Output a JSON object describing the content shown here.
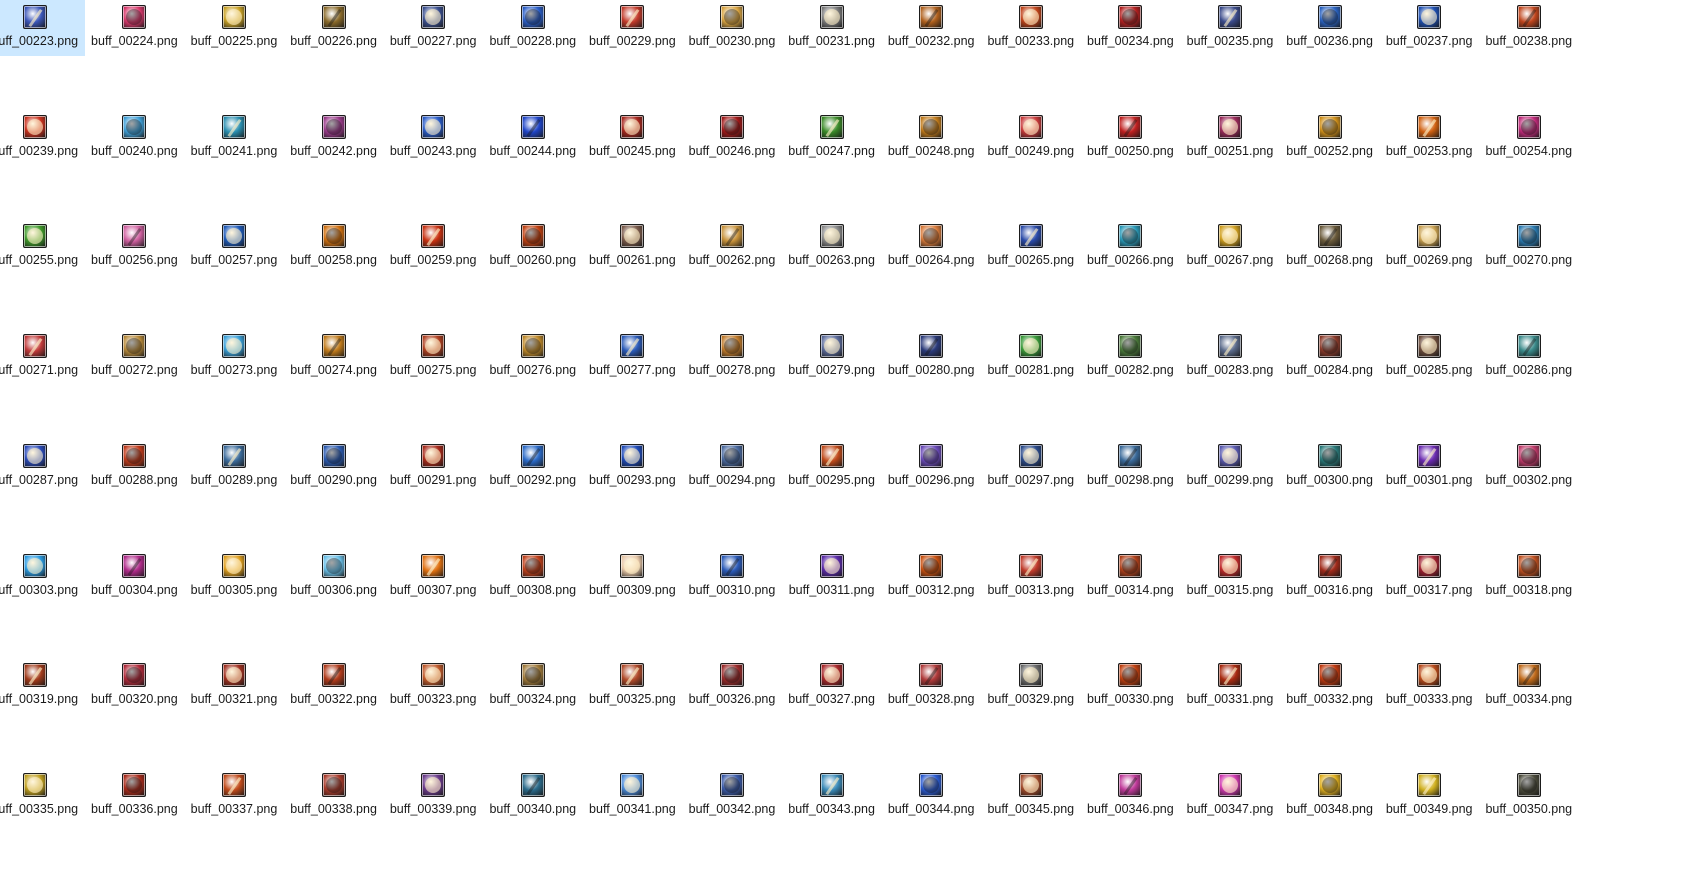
{
  "file_view": {
    "selected_file": "buff_00223.png",
    "files": [
      "buff_00223.png",
      "buff_00224.png",
      "buff_00225.png",
      "buff_00226.png",
      "buff_00227.png",
      "buff_00228.png",
      "buff_00229.png",
      "buff_00230.png",
      "buff_00231.png",
      "buff_00232.png",
      "buff_00233.png",
      "buff_00234.png",
      "buff_00235.png",
      "buff_00236.png",
      "buff_00237.png",
      "buff_00238.png",
      "buff_00239.png",
      "buff_00240.png",
      "buff_00241.png",
      "buff_00242.png",
      "buff_00243.png",
      "buff_00244.png",
      "buff_00245.png",
      "buff_00246.png",
      "buff_00247.png",
      "buff_00248.png",
      "buff_00249.png",
      "buff_00250.png",
      "buff_00251.png",
      "buff_00252.png",
      "buff_00253.png",
      "buff_00254.png",
      "buff_00255.png",
      "buff_00256.png",
      "buff_00257.png",
      "buff_00258.png",
      "buff_00259.png",
      "buff_00260.png",
      "buff_00261.png",
      "buff_00262.png",
      "buff_00263.png",
      "buff_00264.png",
      "buff_00265.png",
      "buff_00266.png",
      "buff_00267.png",
      "buff_00268.png",
      "buff_00269.png",
      "buff_00270.png",
      "buff_00271.png",
      "buff_00272.png",
      "buff_00273.png",
      "buff_00274.png",
      "buff_00275.png",
      "buff_00276.png",
      "buff_00277.png",
      "buff_00278.png",
      "buff_00279.png",
      "buff_00280.png",
      "buff_00281.png",
      "buff_00282.png",
      "buff_00283.png",
      "buff_00284.png",
      "buff_00285.png",
      "buff_00286.png",
      "buff_00287.png",
      "buff_00288.png",
      "buff_00289.png",
      "buff_00290.png",
      "buff_00291.png",
      "buff_00292.png",
      "buff_00293.png",
      "buff_00294.png",
      "buff_00295.png",
      "buff_00296.png",
      "buff_00297.png",
      "buff_00298.png",
      "buff_00299.png",
      "buff_00300.png",
      "buff_00301.png",
      "buff_00302.png",
      "buff_00303.png",
      "buff_00304.png",
      "buff_00305.png",
      "buff_00306.png",
      "buff_00307.png",
      "buff_00308.png",
      "buff_00309.png",
      "buff_00310.png",
      "buff_00311.png",
      "buff_00312.png",
      "buff_00313.png",
      "buff_00314.png",
      "buff_00315.png",
      "buff_00316.png",
      "buff_00317.png",
      "buff_00318.png",
      "buff_00319.png",
      "buff_00320.png",
      "buff_00321.png",
      "buff_00322.png",
      "buff_00323.png",
      "buff_00324.png",
      "buff_00325.png",
      "buff_00326.png",
      "buff_00327.png",
      "buff_00328.png",
      "buff_00329.png",
      "buff_00330.png",
      "buff_00331.png",
      "buff_00332.png",
      "buff_00333.png",
      "buff_00334.png",
      "buff_00335.png",
      "buff_00336.png",
      "buff_00337.png",
      "buff_00338.png",
      "buff_00339.png",
      "buff_00340.png",
      "buff_00341.png",
      "buff_00342.png",
      "buff_00343.png",
      "buff_00344.png",
      "buff_00345.png",
      "buff_00346.png",
      "buff_00347.png",
      "buff_00348.png",
      "buff_00349.png",
      "buff_00350.png"
    ],
    "thumb_colors": [
      "#3b56b8",
      "#d8386b",
      "#c9a227",
      "#8a6a2a",
      "#3a4f8f",
      "#2a5ec8",
      "#c23a2a",
      "#d9a441",
      "#7a7a7a",
      "#b0601c",
      "#c0441a",
      "#b32020",
      "#3a4a8a",
      "#2a62c0",
      "#1e4fb0",
      "#c0451c",
      "#c9321e",
      "#3fa0d8",
      "#2a8fb0",
      "#9a3a8a",
      "#2a5cc8",
      "#1e44c8",
      "#a8281e",
      "#a01818",
      "#3a8a28",
      "#c07a1a",
      "#c83a3a",
      "#c02020",
      "#9a2a5a",
      "#d0901a",
      "#d06010",
      "#c02a7a",
      "#3f9a2a",
      "#d060a0",
      "#1e5ab8",
      "#d07010",
      "#c83010",
      "#c04010",
      "#7a5a4a",
      "#c8923a",
      "#8a8a8a",
      "#d87a3a",
      "#2a4aa8",
      "#2a9ab8",
      "#d0a020",
      "#6a5a3a",
      "#c8a050",
      "#2a7ab0",
      "#c03a3a",
      "#b88a3a",
      "#3aa0d8",
      "#c07a1a",
      "#b04020",
      "#c08a2a",
      "#2a5ab8",
      "#c07a2a",
      "#5a6a9a",
      "#2a3a7a",
      "#3a9a3a",
      "#4a7a3a",
      "#5a6a8a",
      "#8a3a2a",
      "#6a4a3a",
      "#3a8a8a",
      "#2a4ab8",
      "#c03a1a",
      "#3a6a9a",
      "#2a5ab0",
      "#a82a1a",
      "#2a6ac8",
      "#1e4ab8",
      "#4a6aa0",
      "#c04a1a",
      "#6a4ab8",
      "#2a4a8a",
      "#3a6a9a",
      "#5a5ab0",
      "#2a7a7a",
      "#6a2ab0",
      "#c03a6a",
      "#2a9ae0",
      "#b02a8a",
      "#e0a020",
      "#6ac0e8",
      "#e07010",
      "#c0401a",
      "#e8c8a8",
      "#2a5ab8",
      "#5a2aa8",
      "#c85010",
      "#c03a2a",
      "#b0401a",
      "#c02a2a",
      "#a02a1a",
      "#a02030",
      "#c05020",
      "#a03a1a",
      "#b02a3a",
      "#a03020",
      "#b03a1a",
      "#c05a2a",
      "#a07a3a",
      "#b04a2a",
      "#9a2a2a",
      "#a8282a",
      "#b03a3a",
      "#6a6a6a",
      "#c04010",
      "#a82a10",
      "#c03a10",
      "#b84a1a",
      "#c06a1a",
      "#c0a020",
      "#a82a1a",
      "#c04a1a",
      "#a83a2a",
      "#6a3a8a",
      "#2a6a8a",
      "#4a8ad8",
      "#3a5aa8",
      "#3a8ab8",
      "#2a5ad0",
      "#a04a2a",
      "#c03a9a",
      "#d03ab0",
      "#e0b020",
      "#d0b020",
      "#4a4a3a"
    ]
  }
}
